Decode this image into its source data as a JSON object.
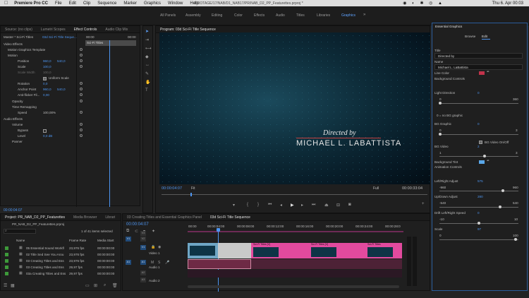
{
  "menubar": {
    "app": "Premiere Pro CC",
    "items": [
      "File",
      "Edit",
      "Clip",
      "Sequence",
      "Marker",
      "Graphics",
      "Window",
      "Help"
    ],
    "path": "/FOOTAGE/17/NAB/D1_NAB17/PR/NAB_D2_PP_Featurettes.prproj *",
    "clock": "Thu 6. Apr 00:03"
  },
  "workspaces": {
    "items": [
      "All Panels",
      "Assembly",
      "Editing",
      "Color",
      "Effects",
      "Audio",
      "Titles",
      "Libraries",
      "Graphics"
    ],
    "active": "Graphics"
  },
  "effect_controls": {
    "tabs": [
      "Source: (no clips)",
      "Lumetri Scopes",
      "Effect Controls",
      "Audio Clip Mix"
    ],
    "active_tab": "Effect Controls",
    "header_left": "Master * Sci-Fi Titles",
    "header_right": "03d Sci-Fi Title Seque...",
    "timecode_start": "00:00",
    "timecode_end": "00:00",
    "clip_name": "Sci-Fi Titles",
    "video_effects": "Video Effects",
    "motion_graphics_template": "Motion Graphics Template",
    "motion": "Motion",
    "position_label": "Position",
    "position_x": "960,0",
    "position_y": "540,0",
    "scale_label": "Scale",
    "scale_value": "100,0",
    "scale_width_label": "Scale Width",
    "scale_width_value": "100,0",
    "uniform_scale": "Uniform Scale",
    "rotation_label": "Rotation",
    "rotation_value": "0,0",
    "anchor_label": "Anchor Point",
    "anchor_x": "960,0",
    "anchor_y": "540,0",
    "antiflicker_label": "Anti-flicker Fil...",
    "antiflicker_value": "0,00",
    "opacity": "Opacity",
    "time_remapping": "Time Remapping",
    "speed_label": "Speed",
    "speed_value": "100,00%",
    "audio_effects": "Audio Effects",
    "volume": "Volume",
    "bypass_label": "Bypass",
    "level_label": "Level",
    "level_value": "0,0 dB",
    "panner": "Panner",
    "footer_tc": "00:00:04:07"
  },
  "program": {
    "title": "Program: 03d Sci-Fi Title Sequence",
    "title_line1": "Directed by",
    "title_line2": "MICHAEL L. LABATTISTA",
    "timecode": "00:00:04:07",
    "fit": "Fit",
    "full": "Full",
    "duration": "00:00:33:04"
  },
  "essential_graphics": {
    "title": "Essential Graphics",
    "tabs": [
      "Browse",
      "Edit"
    ],
    "active_tab": "Edit",
    "title_label": "Title",
    "directed_value": "Directed by",
    "name_label": "Name",
    "name_value": "Michael L. LaBattista",
    "line_color": "Line Color",
    "line_color_hex": "#c2334b",
    "bg_controls": "Background Controls",
    "light_direction": "Light Direction",
    "light_value": "0",
    "light_min": "0",
    "light_max": "360",
    "no_bg": "0 = no BG graphic",
    "bg_graphic": "BG Graphic",
    "bg_graphic_value": "0",
    "bg_graphic_min": "0",
    "bg_graphic_max": "3",
    "bg_video_toggle": "BG Video On/Off",
    "bg_video": "BG Video",
    "bg_video_value": "2",
    "bg_video_min": "1",
    "bg_video_max": "3",
    "bg_tint": "Background Tint",
    "bg_tint_hex": "#5aa7e8",
    "animation_controls": "Animation Controls",
    "lr_adjust": "Left/Right Adjust",
    "lr_value": "575",
    "lr_min": "-960",
    "lr_max": "960",
    "ud_adjust": "Up/Down Adjust",
    "ud_value": "280",
    "ud_min": "-540",
    "ud_max": "540",
    "drift": "Drift Left/Right Speed",
    "drift_value": "0",
    "drift_min": "-10",
    "drift_max": "10",
    "scale": "Scale",
    "scale_value": "97",
    "scale_min": "0",
    "scale_max": "100"
  },
  "project": {
    "tabs": [
      "Project: PR_NAB_D2_PP_Featurettes",
      "Media Browser",
      "Librari"
    ],
    "file": "PR_NAB_D2_PP_Featurettes.prproj",
    "selected_info": "1 of 41 items selected",
    "col_name": "Name",
    "col_frame_rate": "Frame Rate",
    "col_media_start": "Media Start",
    "items": [
      {
        "name": "05 Essential Sound Workfl",
        "fps": "23,976 fps",
        "start": "00:00:00:00",
        "color": "#3d9a3a"
      },
      {
        "name": "02 Title Sed See You Arou",
        "fps": "23,976 fps",
        "start": "00:00:00:00",
        "color": "#3d9a3a"
      },
      {
        "name": "03 Creating Titles and Ess",
        "fps": "23,976 fps",
        "start": "00:00:00:00",
        "color": "#3d9a3a"
      },
      {
        "name": "03 Creating Titles and Ess",
        "fps": "29,97 fps",
        "start": "00:00:00:00",
        "color": "#3d9a3a"
      },
      {
        "name": "03a Creating Titles and Ess",
        "fps": "29,97 fps",
        "start": "00:00:00:00",
        "color": "#3d9a3a"
      }
    ]
  },
  "timeline": {
    "tabs": [
      "03 Creating Titles and Essential Graphics Panel",
      "03d Sci-Fi Title Sequence"
    ],
    "active_tab": "03d Sci-Fi Title Sequence",
    "timecode": "00:00:04:07",
    "ruler": [
      "00:00",
      "00:00:04:00",
      "00:00:08:00",
      "00:00:12:00",
      "00:00:16:00",
      "00:00:20:00",
      "00:00:24:00",
      "00:00:28:0"
    ],
    "tracks": [
      {
        "id": "V3",
        "name": ""
      },
      {
        "id": "V2",
        "name": ""
      },
      {
        "id": "V1",
        "name": "Video 1"
      },
      {
        "id": "A1",
        "name": "Audio 1"
      },
      {
        "id": "A2",
        "name": ""
      },
      {
        "id": "A3",
        "name": "Audio 2"
      }
    ],
    "clip_label": "Sci-Fi Titles [V]",
    "clip_label_short": "Sci-Fi Titles"
  }
}
